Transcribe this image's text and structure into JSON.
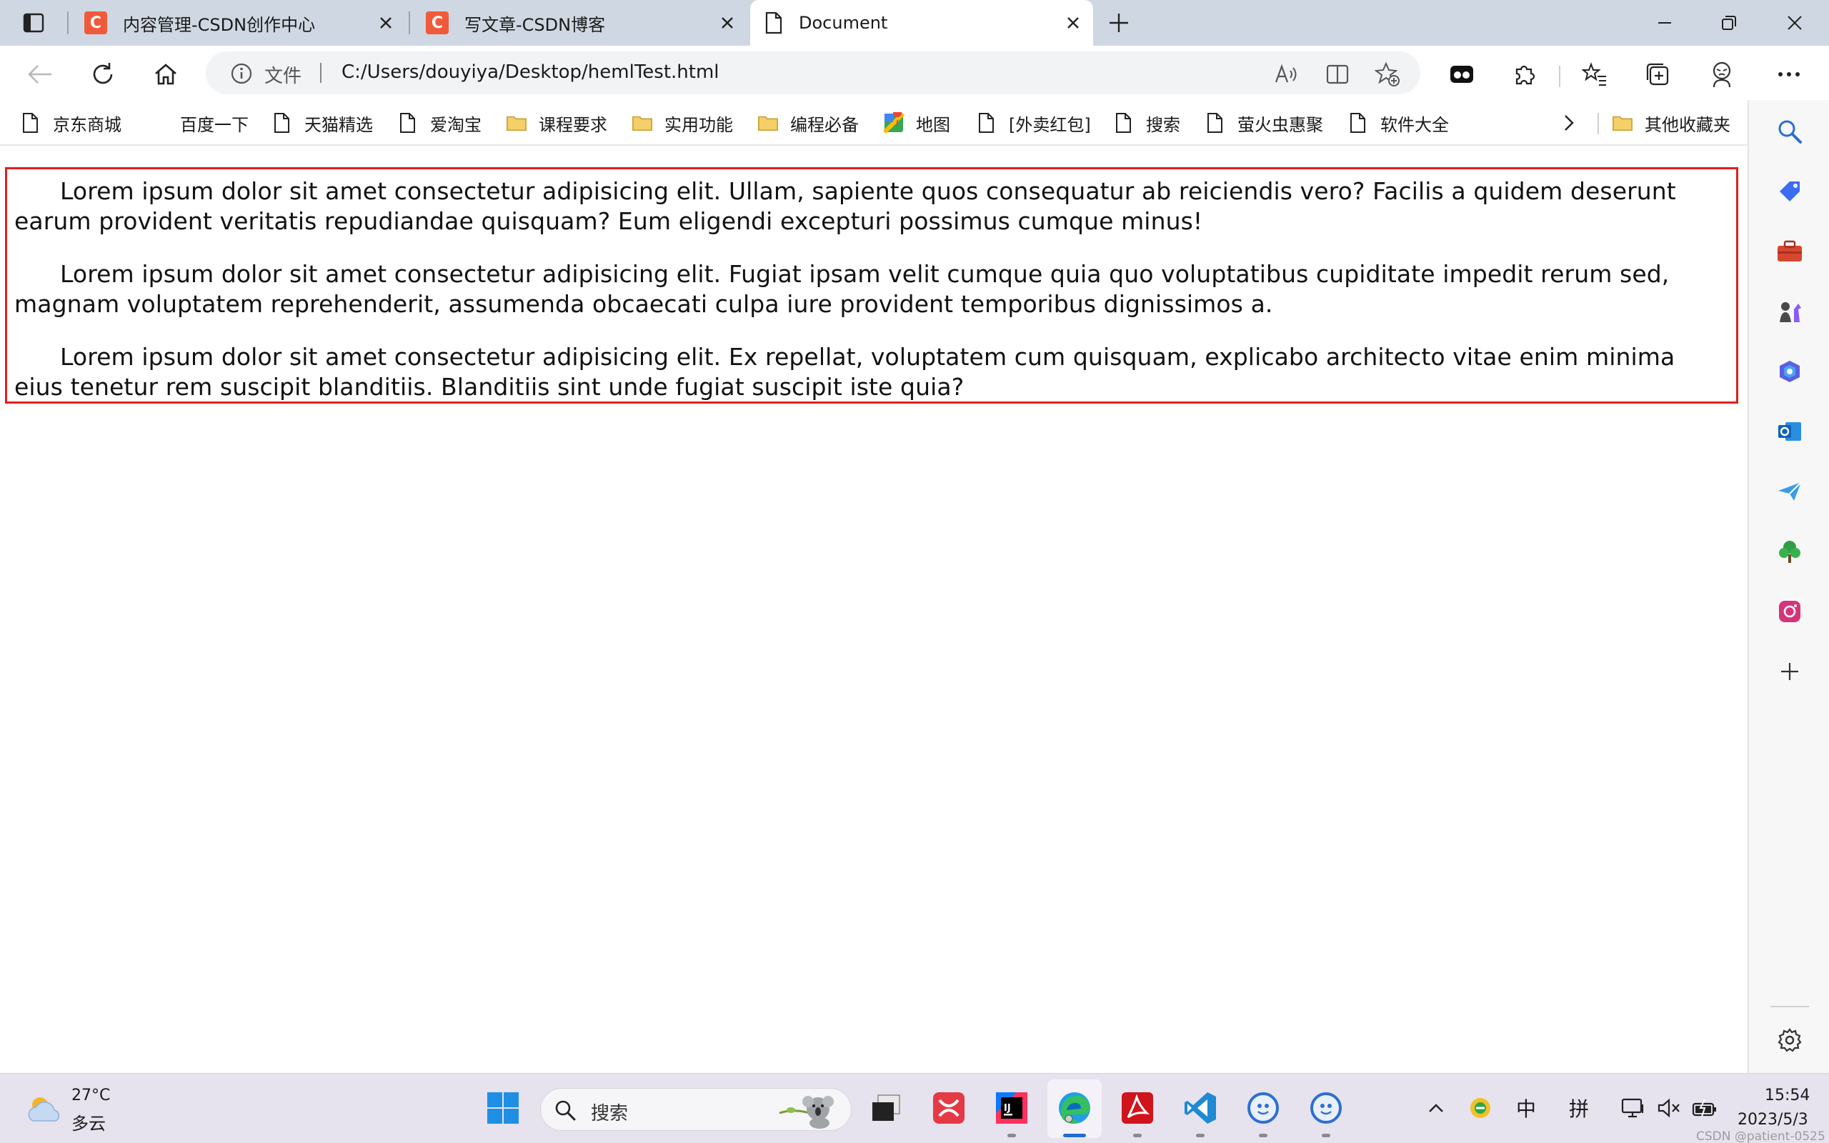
{
  "browser": {
    "tabs": [
      {
        "title": "内容管理-CSDN创作中心",
        "favicon": "C",
        "favicon_color": "#f05a3a"
      },
      {
        "title": "写文章-CSDN博客",
        "favicon": "C",
        "favicon_color": "#f05a3a"
      },
      {
        "title": "Document",
        "favicon": "page-icon",
        "active": true
      }
    ],
    "address": {
      "scheme_label": "文件",
      "url": "C:/Users/douyiya/Desktop/hemlTest.html"
    },
    "bookmarks": [
      {
        "label": "京东商城",
        "icon": "page-icon"
      },
      {
        "label": "百度一下",
        "icon": "none"
      },
      {
        "label": "天猫精选",
        "icon": "page-icon"
      },
      {
        "label": "爱淘宝",
        "icon": "page-icon"
      },
      {
        "label": "课程要求",
        "icon": "folder-icon"
      },
      {
        "label": "实用功能",
        "icon": "folder-icon"
      },
      {
        "label": "编程必备",
        "icon": "folder-icon"
      },
      {
        "label": "地图",
        "icon": "map-icon"
      },
      {
        "label": "[外卖红包]",
        "icon": "page-icon"
      },
      {
        "label": "搜索",
        "icon": "page-icon"
      },
      {
        "label": "萤火虫惠聚",
        "icon": "page-icon"
      },
      {
        "label": "软件大全",
        "icon": "page-icon"
      }
    ],
    "other_favorites": "其他收藏夹"
  },
  "page": {
    "paragraphs": [
      "Lorem ipsum dolor sit amet consectetur adipisicing elit. Ullam, sapiente quos consequatur ab reiciendis vero? Facilis a quidem deserunt earum provident veritatis repudiandae quisquam? Eum eligendi excepturi possimus cumque minus!",
      "Lorem ipsum dolor sit amet consectetur adipisicing elit. Fugiat ipsam velit cumque quia quo voluptatibus cupiditate impedit rerum sed, magnam voluptatem reprehenderit, assumenda obcaecati culpa iure provident temporibus dignissimos a.",
      "Lorem ipsum dolor sit amet consectetur adipisicing elit. Ex repellat, voluptatem cum quisquam, explicabo architecto vitae enim minima eius tenetur rem suscipit blanditiis. Blanditiis sint unde fugiat suscipit iste quia?"
    ],
    "border_color": "#e01e1e"
  },
  "taskbar": {
    "weather": {
      "temp": "27°C",
      "desc": "多云"
    },
    "search_label": "搜索",
    "ime_lang": "中",
    "ime_mode": "拼",
    "time": "15:54",
    "date": "2023/5/3",
    "watermark": "CSDN @patient-0525"
  }
}
